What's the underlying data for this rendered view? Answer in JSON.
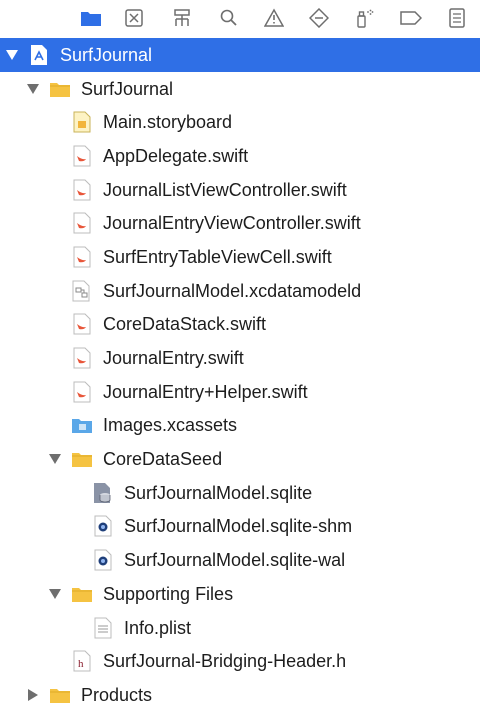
{
  "toolbar": {
    "icons": [
      "folder-icon",
      "source-control-icon",
      "hierarchy-icon",
      "search-icon",
      "warning-icon",
      "test-icon",
      "debug-icon",
      "breakpoint-icon",
      "report-icon"
    ]
  },
  "tree": {
    "project": {
      "label": "SurfJournal",
      "expanded": true
    },
    "group_main": {
      "label": "SurfJournal",
      "expanded": true
    },
    "files": [
      {
        "label": "Main.storyboard",
        "type": "storyboard"
      },
      {
        "label": "AppDelegate.swift",
        "type": "swift"
      },
      {
        "label": "JournalListViewController.swift",
        "type": "swift"
      },
      {
        "label": "JournalEntryViewController.swift",
        "type": "swift"
      },
      {
        "label": "SurfEntryTableViewCell.swift",
        "type": "swift"
      },
      {
        "label": "SurfJournalModel.xcdatamodeld",
        "type": "datamodel"
      },
      {
        "label": "CoreDataStack.swift",
        "type": "swift"
      },
      {
        "label": "JournalEntry.swift",
        "type": "swift"
      },
      {
        "label": "JournalEntry+Helper.swift",
        "type": "swift"
      },
      {
        "label": "Images.xcassets",
        "type": "assets"
      }
    ],
    "group_seed": {
      "label": "CoreDataSeed",
      "expanded": true
    },
    "seed_files": [
      {
        "label": "SurfJournalModel.sqlite",
        "type": "sqlite"
      },
      {
        "label": "SurfJournalModel.sqlite-shm",
        "type": "sqlite-aux"
      },
      {
        "label": "SurfJournalModel.sqlite-wal",
        "type": "sqlite-aux"
      }
    ],
    "group_support": {
      "label": "Supporting Files",
      "expanded": true
    },
    "support_files": [
      {
        "label": "Info.plist",
        "type": "plist"
      }
    ],
    "bridging": {
      "label": "SurfJournal-Bridging-Header.h",
      "type": "header"
    },
    "products": {
      "label": "Products",
      "expanded": false
    }
  },
  "colors": {
    "selection": "#2f6fe6",
    "folder": "#f5c342",
    "swift": "#e8563a",
    "icon_gray": "#6e6e6e"
  }
}
